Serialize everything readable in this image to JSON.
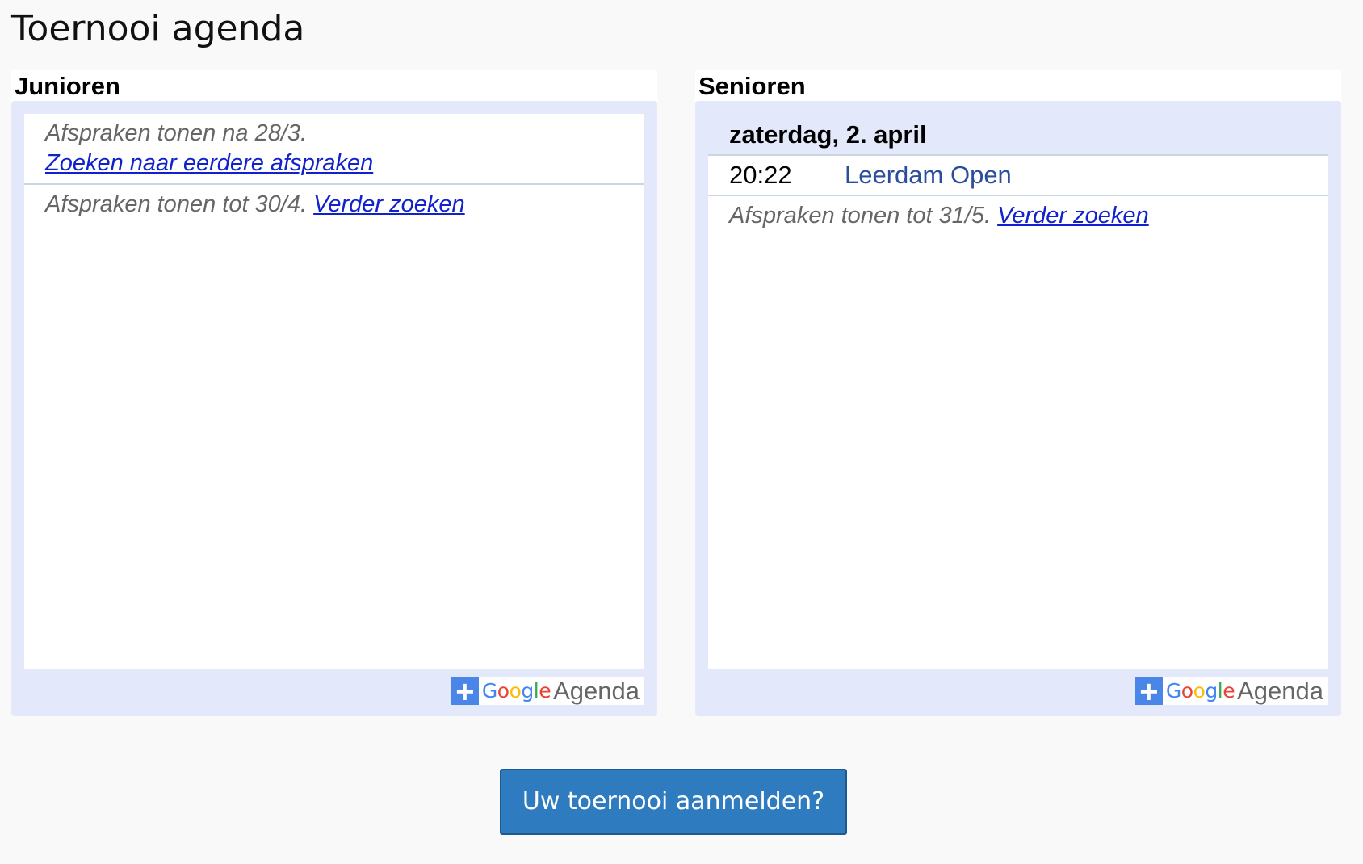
{
  "page": {
    "title": "Toernooi agenda"
  },
  "juniors": {
    "heading": "Junioren",
    "earlier_notice": "Afspraken tonen na 28/3.",
    "earlier_link": "Zoeken naar eerdere afspraken",
    "later_notice": "Afspraken tonen tot 30/4.",
    "later_link": "Verder zoeken",
    "events": []
  },
  "seniors": {
    "heading": "Senioren",
    "day_label": "zaterdag, 2. april",
    "events": [
      {
        "time": "20:22",
        "title": "Leerdam Open"
      }
    ],
    "later_notice": "Afspraken tonen tot 31/5.",
    "later_link": "Verder zoeken"
  },
  "badge": {
    "plus": "+",
    "google_letters": [
      "G",
      "o",
      "o",
      "g",
      "l",
      "e"
    ],
    "agenda": "Agenda",
    "colors": [
      "#4285f4",
      "#ea4335",
      "#fbbc05",
      "#4285f4",
      "#34a853",
      "#ea4335"
    ]
  },
  "cta": {
    "label": "Uw toernooi aanmelden?"
  },
  "colors": {
    "frame": "#e3e9fa",
    "link": "#1122cc",
    "event_title": "#2a4e9c",
    "button": "#2f7bbf",
    "badge_plus": "#4a86e8"
  }
}
